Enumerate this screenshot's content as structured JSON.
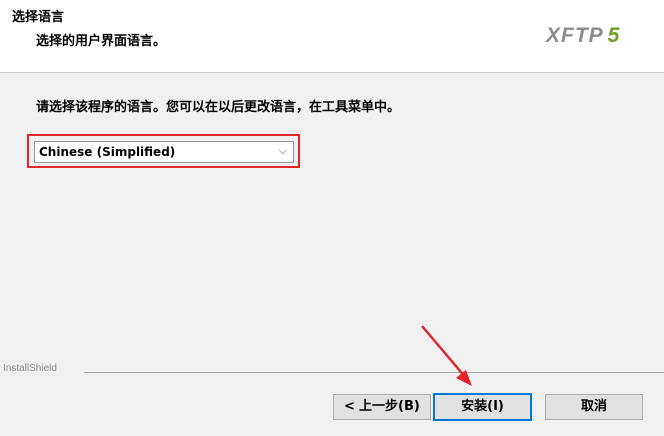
{
  "header": {
    "title": "选择语言",
    "subtitle": "选择的用户界面语言。",
    "logo_text": "XFTP",
    "logo_number": "5"
  },
  "main": {
    "instruction": "请选择该程序的语言。您可以在以后更改语言，在工具菜单中。",
    "language_select": {
      "selected": "Chinese (Simplified)"
    }
  },
  "footer": {
    "brand": "InstallShield",
    "back_label": "上一步(B)",
    "install_label": "安装(I)",
    "cancel_label": "取消"
  },
  "colors": {
    "highlight": "#e0262b",
    "default_button_border": "#0078d7",
    "logo_accent": "#6f9f2a"
  },
  "icons": [
    "chevron-down-icon",
    "chevron-left-icon",
    "red-arrow-annotation"
  ]
}
